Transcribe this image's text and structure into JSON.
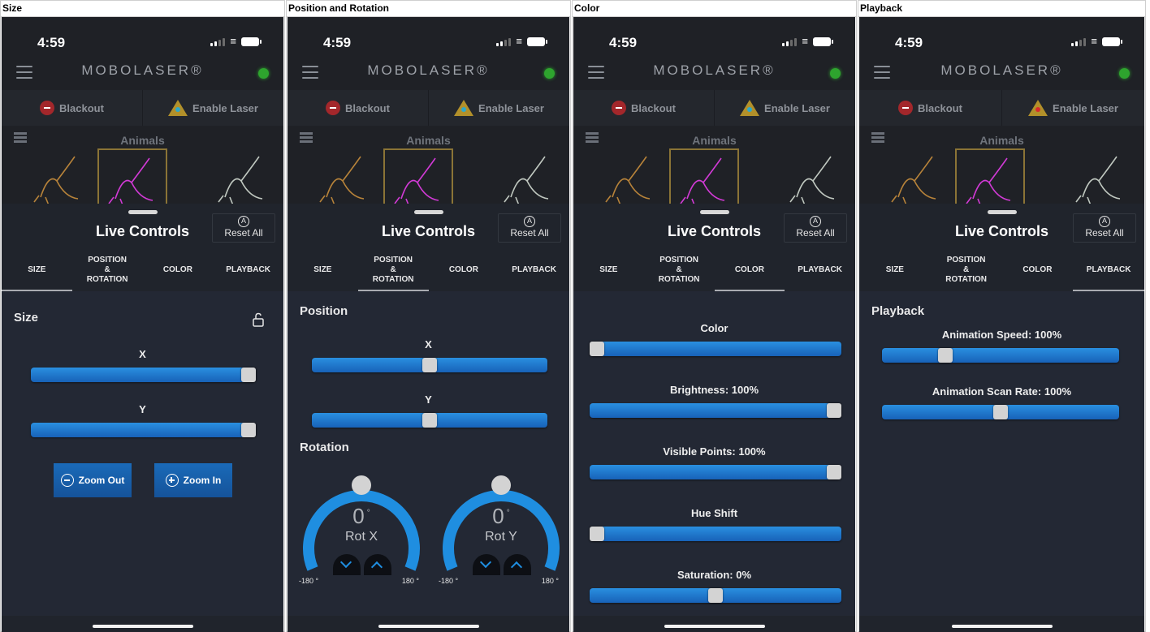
{
  "panels": [
    {
      "header": "Size",
      "active_tab": 0
    },
    {
      "header": "Position and Rotation",
      "active_tab": 1
    },
    {
      "header": "Color",
      "active_tab": 2
    },
    {
      "header": "Playback",
      "active_tab": 3
    }
  ],
  "status": {
    "time": "4:59"
  },
  "app": {
    "brand": "MOBOLASER®",
    "connection_led_color": "#2ea42e"
  },
  "actions": {
    "blackout": "Blackout",
    "enable_laser": "Enable Laser"
  },
  "gallery": {
    "title": "Animals"
  },
  "sheet": {
    "title": "Live Controls",
    "reset_all": "Reset All",
    "tabs": [
      "SIZE",
      "POSITION\n&\nROTATION",
      "COLOR",
      "PLAYBACK"
    ]
  },
  "size": {
    "title": "Size",
    "x_label": "X",
    "x_value": 1.0,
    "y_label": "Y",
    "y_value": 1.0,
    "zoom_out": "Zoom Out",
    "zoom_in": "Zoom In"
  },
  "position": {
    "title": "Position",
    "x_label": "X",
    "x_value": 0.5,
    "y_label": "Y",
    "y_value": 0.5
  },
  "rotation": {
    "title": "Rotation",
    "dials": [
      {
        "value": "0",
        "unit": "°",
        "name": "Rot X",
        "min": "-180 °",
        "max": "180 °"
      },
      {
        "value": "0",
        "unit": "°",
        "name": "Rot Y",
        "min": "-180 °",
        "max": "180 °"
      }
    ]
  },
  "color": {
    "sliders": [
      {
        "label": "Color",
        "value": 0.0
      },
      {
        "label": "Brightness: 100%",
        "value": 1.0
      },
      {
        "label": "Visible Points: 100%",
        "value": 1.0
      },
      {
        "label": "Hue Shift",
        "value": 0.0
      },
      {
        "label": "Saturation: 0%",
        "value": 0.5
      }
    ]
  },
  "playback": {
    "title": "Playback",
    "sliders": [
      {
        "label": "Animation Speed: 100%",
        "value": 0.25
      },
      {
        "label": "Animation Scan Rate: 100%",
        "value": 0.5
      }
    ]
  },
  "colors": {
    "accent_blue": "#1f8ee0",
    "sheet_bg": "#20242c",
    "blackout_red": "#a3272b",
    "laser_yellow": "#b2902a"
  }
}
